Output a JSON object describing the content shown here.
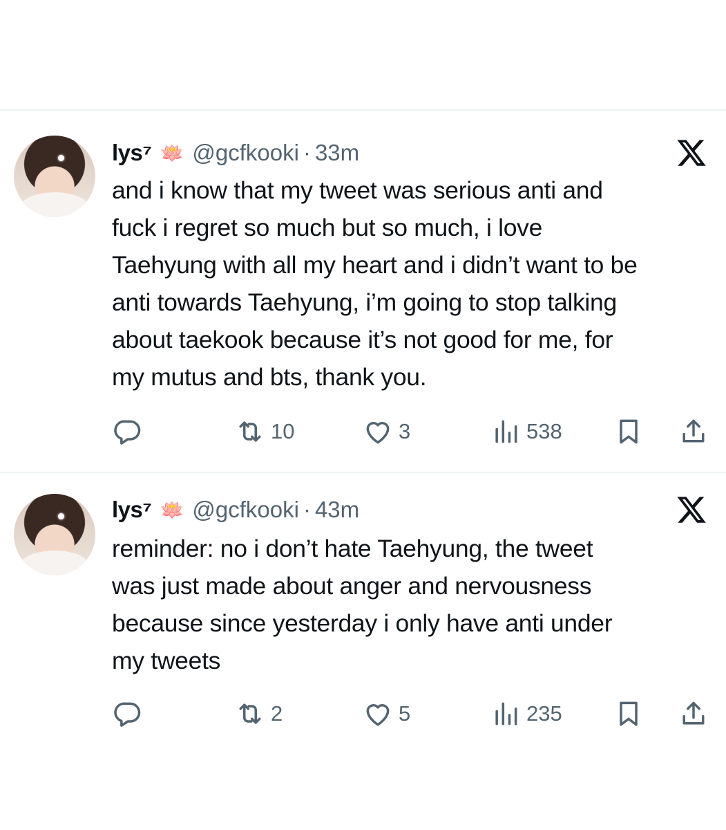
{
  "tweets": [
    {
      "display_name": "lys⁷",
      "badge_emoji": "🪷",
      "handle": "@gcfkooki",
      "separator": "·",
      "time": "33m",
      "text": "and i know that my tweet was serious anti and\nfuck i regret so much but so much, i love\nTaehyung with all my heart and i didn’t want to be\nanti towards Taehyung, i’m going to stop talking\nabout taekook because it’s not good for me, for\nmy mutus and bts, thank you.",
      "reposts": "10",
      "likes": "3",
      "views": "538"
    },
    {
      "display_name": "lys⁷",
      "badge_emoji": "🪷",
      "handle": "@gcfkooki",
      "separator": "·",
      "time": "43m",
      "text": "reminder: no i don’t hate Taehyung, the tweet\nwas just made about anger and nervousness\nbecause since yesterday i only have anti under\nmy tweets",
      "reposts": "2",
      "likes": "5",
      "views": "235"
    }
  ],
  "icons": {
    "reply": "reply-icon",
    "repost": "repost-icon",
    "like": "heart-icon",
    "views": "views-icon",
    "bookmark": "bookmark-icon",
    "share": "share-icon",
    "brand": "x-logo-icon"
  },
  "colors": {
    "text": "#0f1419",
    "muted": "#536471",
    "divider": "#eff3f4"
  }
}
